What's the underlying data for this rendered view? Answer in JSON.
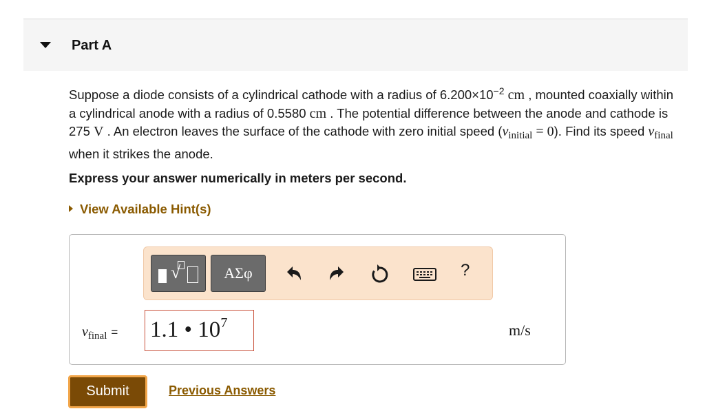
{
  "part": {
    "title": "Part A"
  },
  "question": {
    "t1": "Suppose a diode consists of a cylindrical cathode with a radius of 6.200×10",
    "exp1": "−2",
    "unit_cm": "cm",
    "t2": " , mounted coaxially within a cylindrical anode with a radius of 0.5580 ",
    "unit_cm2": "cm",
    "t3": " . The potential difference between the anode and cathode is 275 ",
    "unit_v": "V",
    "t4": " . An electron leaves the surface of the cathode with zero initial speed (",
    "v_initial_sym": "v",
    "v_initial_sub": "initial",
    "eq_zero": " = 0",
    "t5": "). Find its speed ",
    "v_final_sym": "v",
    "v_final_sub": "final",
    "t6": " when it strikes the anode."
  },
  "instruction": "Express your answer numerically in meters per second.",
  "hint": {
    "label": "View Available Hint(s)"
  },
  "toolbar": {
    "greek_label": "ΑΣφ",
    "help_label": "?"
  },
  "answer": {
    "var_sym": "v",
    "var_sub": "final",
    "eq": "=",
    "mantissa": "1.1 • 10",
    "exponent": "7",
    "units": "m/s"
  },
  "actions": {
    "submit_label": "Submit",
    "previous_answers_label": "Previous Answers"
  },
  "colors": {
    "accent_link": "#8a5a00",
    "submit_bg": "#7a4a06",
    "submit_border": "#f2a64a",
    "toolbar_bg": "#fbe3cc",
    "input_border": "#c8503a"
  },
  "icons": [
    "caret-down-icon",
    "caret-right-icon",
    "templates-icon",
    "undo-icon",
    "redo-icon",
    "reset-icon",
    "keyboard-icon",
    "help-icon"
  ]
}
